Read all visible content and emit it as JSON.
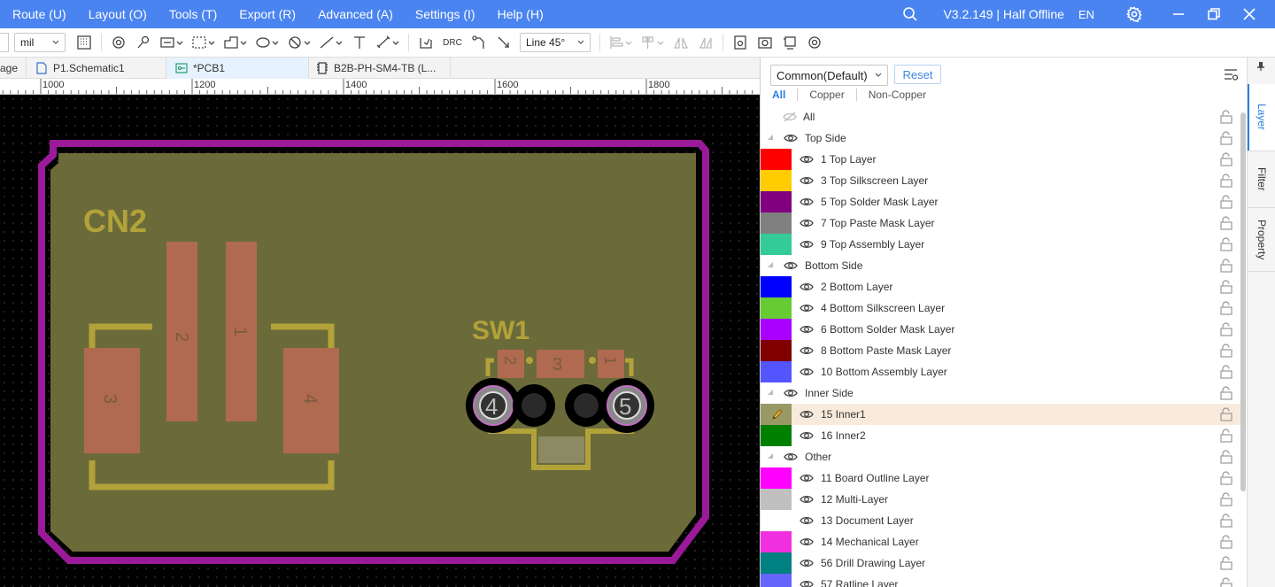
{
  "menu": {
    "items": [
      "Route (U)",
      "Layout (O)",
      "Tools (T)",
      "Export (R)",
      "Advanced (A)",
      "Settings (I)",
      "Help (H)"
    ],
    "version": "V3.2.149 | Half Offline",
    "language": "EN"
  },
  "toolbar": {
    "unit": "mil",
    "route_mode": "Line 45°",
    "drc_label": "DRC"
  },
  "tabs": [
    {
      "label": "age"
    },
    {
      "label": "P1.Schematic1"
    },
    {
      "label": "*PCB1"
    },
    {
      "label": "B2B-PH-SM4-TB (L..."
    }
  ],
  "ruler": {
    "labels": [
      "1000",
      "1200",
      "1400",
      "1600",
      "1800"
    ]
  },
  "board": {
    "designators": [
      "CN2",
      "SW1"
    ],
    "cn2_pads": [
      "2",
      "1",
      "3",
      "4"
    ],
    "sw1_pads": [
      "2",
      "3",
      "1",
      "4",
      "5"
    ],
    "colors": {
      "outline": "#9a1a9a",
      "fill": "#6b6b3a",
      "pad": "#b06a50",
      "silk": "#b3a23a"
    }
  },
  "panel": {
    "preset": "Common(Default)",
    "reset_label": "Reset",
    "filters": [
      "All",
      "Copper",
      "Non-Copper"
    ],
    "all_label": "All",
    "groups": [
      {
        "name": "Top Side",
        "layers": [
          {
            "name": "1 Top Layer",
            "color": "#ff0000"
          },
          {
            "name": "3 Top Silkscreen Layer",
            "color": "#ffcc00"
          },
          {
            "name": "5 Top Solder Mask Layer",
            "color": "#800080"
          },
          {
            "name": "7 Top Paste Mask Layer",
            "color": "#808080"
          },
          {
            "name": "9 Top Assembly Layer",
            "color": "#33cc99"
          }
        ]
      },
      {
        "name": "Bottom Side",
        "layers": [
          {
            "name": "2 Bottom Layer",
            "color": "#0000ff"
          },
          {
            "name": "4 Bottom Silkscreen Layer",
            "color": "#66cc33"
          },
          {
            "name": "6 Bottom Solder Mask Layer",
            "color": "#aa00ff"
          },
          {
            "name": "8 Bottom Paste Mask Layer",
            "color": "#800000"
          },
          {
            "name": "10 Bottom Assembly Layer",
            "color": "#5555ff"
          }
        ]
      },
      {
        "name": "Inner Side",
        "layers": [
          {
            "name": "15 Inner1",
            "color": "#999966",
            "selected": true
          },
          {
            "name": "16 Inner2",
            "color": "#008000"
          }
        ]
      },
      {
        "name": "Other",
        "layers": [
          {
            "name": "11 Board Outline Layer",
            "color": "#ff00ff"
          },
          {
            "name": "12 Multi-Layer",
            "color": "#c0c0c0"
          },
          {
            "name": "13 Document Layer",
            "color": "#ffffff"
          },
          {
            "name": "14 Mechanical Layer",
            "color": "#f030e0"
          },
          {
            "name": "56 Drill Drawing Layer",
            "color": "#008080"
          },
          {
            "name": "57 Ratline Layer",
            "color": "#6666ff"
          }
        ]
      }
    ]
  },
  "side_tabs": [
    "Layer",
    "Filter",
    "Property"
  ]
}
